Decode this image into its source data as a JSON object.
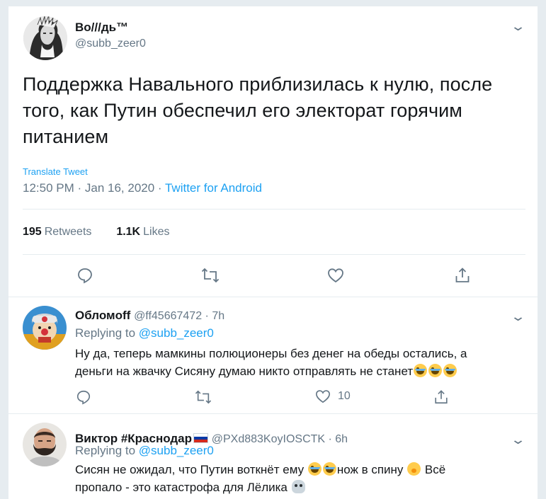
{
  "main_tweet": {
    "name": "Bo///дь™",
    "handle": "@subb_zeer0",
    "text": "Поддержка Навального приблизилась к нулю, после того, как Путин обеспечил его электорат горячим питанием",
    "translate_label": "Translate Tweet",
    "time": "12:50 PM · Jan 16, 2020 · ",
    "source": "Twitter for Android",
    "retweets_count": "195",
    "retweets_label": "Retweets",
    "likes_count": "1.1K",
    "likes_label": "Likes",
    "icons": [
      "reply-icon",
      "retweet-icon",
      "like-icon",
      "share-icon"
    ]
  },
  "replies": [
    {
      "name": "Обломoff",
      "handle": "@ff45667472 · 7h",
      "replying_prefix": "Replying to ",
      "replying_to": "@subb_zeer0",
      "text_1": "Ну да, теперь мамкины полюционеры без денег на обеды остались, а",
      "text_2": "деньги на жвачку Сисяну думаю никто отправлять не станет",
      "like_count": "10"
    },
    {
      "name": "Виктор #Краснодар",
      "handle": "@PXd883KoyIOSCTK · 6h",
      "replying_prefix": "Replying to ",
      "replying_to": "@subb_zeer0",
      "text_1a": "Сисян не ожидал, что Путин воткнёт ему ",
      "text_1b": "нож в спину ",
      "text_1c": " Всё",
      "text_2": "пропало - это катастрофа для Лёлика "
    }
  ],
  "colors": {
    "accent": "#1da1f2",
    "secondary_text": "#657786",
    "divider": "#e6ecf0",
    "background": "#e6ecf0"
  }
}
